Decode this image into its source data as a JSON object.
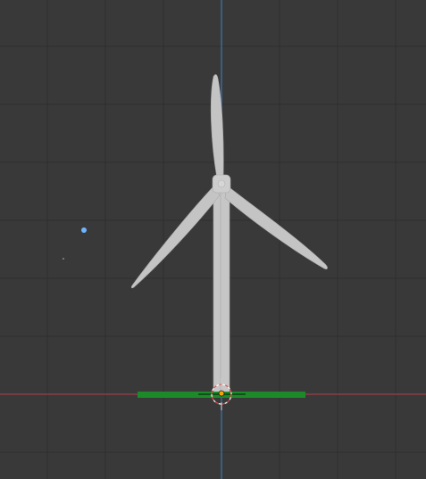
{
  "viewport": {
    "view": "front-orthographic",
    "grid": true,
    "object": "wind-turbine"
  },
  "colors": {
    "background": "#393939",
    "grid_line": "#2f2f2f",
    "x_axis": "#9a3e4a",
    "z_axis": "#3d6ea6",
    "ground_plane": "#1d8a2a",
    "turbine_body": "#c4c4c4",
    "origin": "#f5a20a",
    "light": "#6fb4ff"
  },
  "icons": {
    "cursor": "3d-cursor-icon",
    "origin": "object-origin-icon",
    "light": "light-icon"
  }
}
